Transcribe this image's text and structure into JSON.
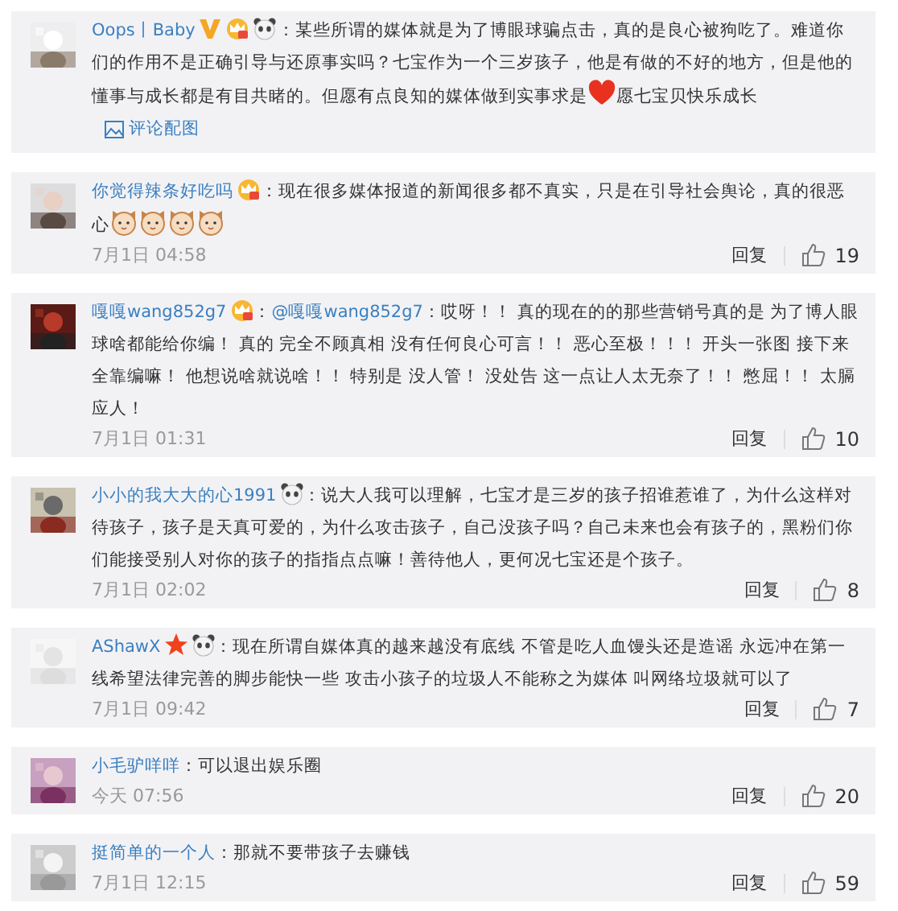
{
  "comments": [
    {
      "avatar": {
        "kind": "picture"
      },
      "username": "Oops丨Baby",
      "badges": [
        {
          "kind": "verified"
        },
        {
          "kind": "crown"
        },
        {
          "kind": "panda"
        }
      ],
      "text": [
        {
          "kind": "text",
          "value": "：某些所谓的媒体就是为了博眼球骗点击，真的是良心被狗吃了。难道你们的作用不是正确引导与还原事实吗？七宝作为一个三岁孩子，他是有做的不好的地方，但是他的懂事与成长都是有目共睹的。但愿有点良知的媒体做到实事求是"
        },
        {
          "kind": "heart"
        },
        {
          "kind": "text",
          "value": "愿七宝贝快乐成长"
        }
      ],
      "image_link": "评论配图"
    },
    {
      "avatar": {
        "kind": "picture"
      },
      "username": "你觉得辣条好吃吗",
      "badges": [
        {
          "kind": "crown"
        }
      ],
      "text": [
        {
          "kind": "text",
          "value": "：现在很多媒体报道的新闻很多都不真实，只是在引导社会舆论，真的很恶心"
        },
        {
          "kind": "cat"
        },
        {
          "kind": "cat"
        },
        {
          "kind": "cat"
        },
        {
          "kind": "cat"
        }
      ],
      "time": "7月1日 04:58",
      "reply": "回复",
      "likes": "19"
    },
    {
      "avatar": {
        "kind": "picture"
      },
      "username": "嘎嘎wang852g7",
      "badges": [
        {
          "kind": "crown"
        }
      ],
      "text": [
        {
          "kind": "text",
          "value": "："
        },
        {
          "kind": "mention",
          "value": "@嘎嘎wang852g7"
        },
        {
          "kind": "text",
          "value": "：哎呀！！ 真的现在的的那些营销号真的是 为了博人眼球啥都能给你编！ 真的 完全不顾真相 没有任何良心可言！！ 恶心至极！！！ 开头一张图 接下来全靠编嘛！ 他想说啥就说啥！！ 特别是 没人管！ 没处告 这一点让人太无奈了！！ 憋屈！！ 太膈应人！"
        }
      ],
      "time": "7月1日 01:31",
      "reply": "回复",
      "likes": "10"
    },
    {
      "avatar": {
        "kind": "picture"
      },
      "username": "小小的我大大的心1991",
      "badges": [
        {
          "kind": "panda"
        }
      ],
      "text": [
        {
          "kind": "text",
          "value": "：说大人我可以理解，七宝才是三岁的孩子招谁惹谁了，为什么这样对待孩子，孩子是天真可爱的，为什么攻击孩子，自己没孩子吗？自己未来也会有孩子的，黑粉们你们能接受别人对你的孩子的指指点点嘛！善待他人，更何况七宝还是个孩子。"
        }
      ],
      "time": "7月1日 02:02",
      "reply": "回复",
      "likes": "8"
    },
    {
      "avatar": {
        "kind": "picture"
      },
      "username": "AShawX",
      "badges": [
        {
          "kind": "star"
        },
        {
          "kind": "panda"
        }
      ],
      "text": [
        {
          "kind": "text",
          "value": "：现在所谓自媒体真的越来越没有底线 不管是吃人血馒头还是造谣 永远冲在第一线希望法律完善的脚步能快一些 攻击小孩子的垃圾人不能称之为媒体 叫网络垃圾就可以了"
        }
      ],
      "time": "7月1日 09:42",
      "reply": "回复",
      "likes": "7"
    },
    {
      "avatar": {
        "kind": "picture"
      },
      "username": "小毛驴咩咩",
      "text": [
        {
          "kind": "text",
          "value": "：可以退出娱乐圈"
        }
      ],
      "time": "今天 07:56",
      "reply": "回复",
      "likes": "20"
    },
    {
      "avatar": {
        "kind": "picture"
      },
      "username": "挺简单的一个人",
      "text": [
        {
          "kind": "text",
          "value": "：那就不要带孩子去赚钱"
        }
      ],
      "time": "7月1日 12:15",
      "reply": "回复",
      "likes": "59"
    }
  ]
}
